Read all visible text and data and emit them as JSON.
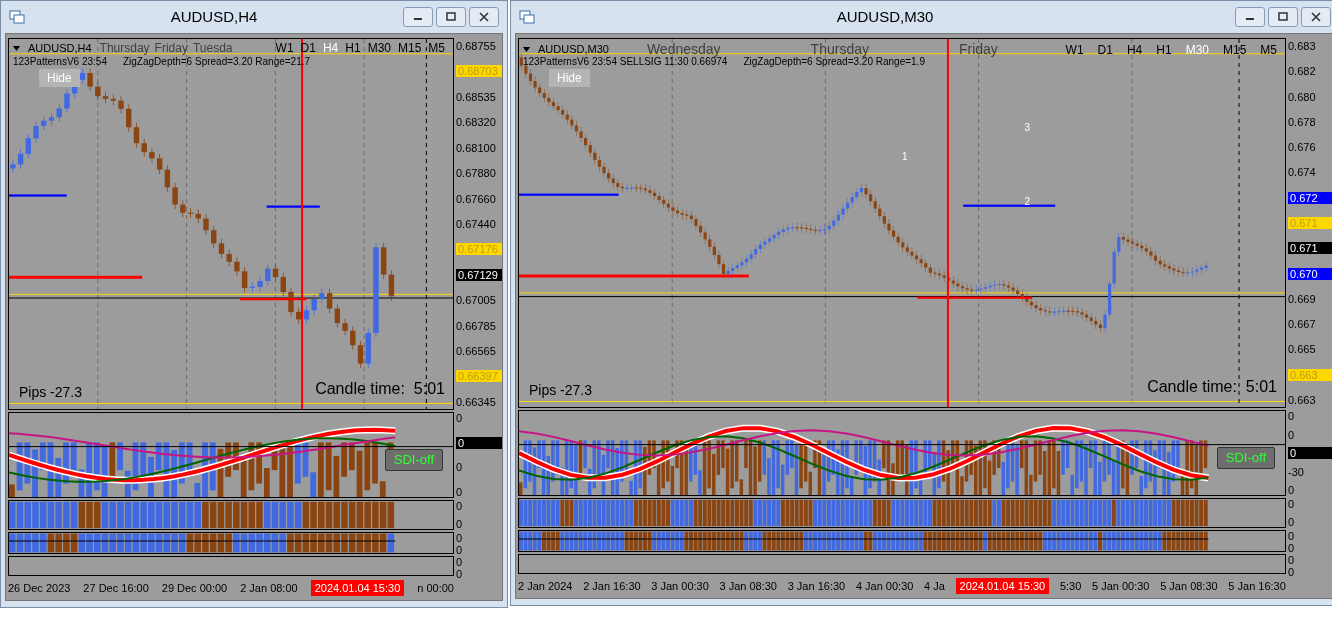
{
  "windows": [
    {
      "title": "AUDUSD,H4",
      "symbol_label": "AUDUSD,H4",
      "indicator_info": "123PatternsV6  23:54",
      "indicator_info_tail": "ZigZagDepth=6  Spread=3.20  Range=21.7",
      "day_labels": [
        "Thursday",
        "Friday",
        "Tuesda"
      ],
      "timeframes": [
        {
          "label": "W1",
          "selected": false
        },
        {
          "label": "D1",
          "selected": false
        },
        {
          "label": "H4",
          "selected": true
        },
        {
          "label": "H1",
          "selected": false
        },
        {
          "label": "M30",
          "selected": false
        },
        {
          "label": "M15",
          "selected": false
        },
        {
          "label": "M5",
          "selected": false
        }
      ],
      "hide_button": "Hide",
      "pips": "Pips -27.3",
      "candle_time": "Candle time:  5:01",
      "sdi_button": "SDI-off",
      "price_axis": [
        {
          "label": "0.68755",
          "kind": "tick"
        },
        {
          "label": "0.68703",
          "kind": "tag",
          "color": "#ffd700"
        },
        {
          "label": "0.68535",
          "kind": "tick"
        },
        {
          "label": "0.68320",
          "kind": "tick"
        },
        {
          "label": "0.68100",
          "kind": "tick"
        },
        {
          "label": "0.67880",
          "kind": "tick"
        },
        {
          "label": "0.67660",
          "kind": "tick"
        },
        {
          "label": "0.67440",
          "kind": "tick"
        },
        {
          "label": "0.67176",
          "kind": "tag",
          "color": "#ffd700"
        },
        {
          "label": "0.67129",
          "kind": "tag",
          "color": "#000000"
        },
        {
          "label": "0.67005",
          "kind": "tick"
        },
        {
          "label": "0.66785",
          "kind": "tick"
        },
        {
          "label": "0.66565",
          "kind": "tick"
        },
        {
          "label": "0.66397",
          "kind": "tag",
          "color": "#ffd700"
        },
        {
          "label": "0.66345",
          "kind": "tick"
        }
      ],
      "indicator_panels": [
        {
          "axis": [
            {
              "label": "0",
              "kind": "tick"
            },
            {
              "label": "0",
              "kind": "tag",
              "color": "#000000"
            },
            {
              "label": "0",
              "kind": "tick"
            },
            {
              "label": "0",
              "kind": "tick"
            }
          ]
        },
        {
          "axis": [
            {
              "label": "0",
              "kind": "tick"
            },
            {
              "label": "0",
              "kind": "tick"
            }
          ]
        },
        {
          "axis": [
            {
              "label": "0",
              "kind": "tick"
            },
            {
              "label": "0",
              "kind": "tick"
            }
          ]
        },
        {
          "axis": [
            {
              "label": "0",
              "kind": "tick"
            },
            {
              "label": "0",
              "kind": "tick"
            }
          ]
        }
      ],
      "time_axis": [
        {
          "label": "26 Dec 2023",
          "kind": "tick"
        },
        {
          "label": "27 Dec 16:00",
          "kind": "tick"
        },
        {
          "label": "29 Dec 00:00",
          "kind": "tick"
        },
        {
          "label": "2 Jan 08:00",
          "kind": "tick"
        },
        {
          "label": "2024.01.04 15:30",
          "kind": "cursor"
        },
        {
          "label": "n 00:00",
          "kind": "tick"
        }
      ]
    },
    {
      "title": "AUDUSD,M30",
      "symbol_label": "AUDUSD,M30",
      "indicator_info": "123PatternsV6  23:54  SELLSIG  11:30  0.66974",
      "indicator_info_tail": "ZigZagDepth=6  Spread=3.20  Range=1.9",
      "day_labels": [
        "Wednesday",
        "Thursday",
        "Friday"
      ],
      "timeframes": [
        {
          "label": "W1",
          "selected": false
        },
        {
          "label": "D1",
          "selected": false
        },
        {
          "label": "H4",
          "selected": false
        },
        {
          "label": "H1",
          "selected": false
        },
        {
          "label": "M30",
          "selected": true
        },
        {
          "label": "M15",
          "selected": false
        },
        {
          "label": "M5",
          "selected": false
        }
      ],
      "hide_button": "Hide",
      "chart_labels": [
        "1",
        "2",
        "3"
      ],
      "pips": "Pips -27.3",
      "candle_time": "Candle time:  5:01",
      "sdi_button": "SDI-off",
      "price_axis": [
        {
          "label": "0.683",
          "kind": "tick"
        },
        {
          "label": "0.682",
          "kind": "tick"
        },
        {
          "label": "0.680",
          "kind": "tick"
        },
        {
          "label": "0.678",
          "kind": "tick"
        },
        {
          "label": "0.676",
          "kind": "tick"
        },
        {
          "label": "0.674",
          "kind": "tick"
        },
        {
          "label": "0.672",
          "kind": "tag",
          "color": "#0000ff"
        },
        {
          "label": "0.671",
          "kind": "tag",
          "color": "#ffd700"
        },
        {
          "label": "0.671",
          "kind": "tag",
          "color": "#000000"
        },
        {
          "label": "0.670",
          "kind": "tag",
          "color": "#0000ff"
        },
        {
          "label": "0.669",
          "kind": "tick"
        },
        {
          "label": "0.667",
          "kind": "tick"
        },
        {
          "label": "0.665",
          "kind": "tick"
        },
        {
          "label": "0.663",
          "kind": "tag",
          "color": "#ffd700"
        },
        {
          "label": "0.663",
          "kind": "tick"
        }
      ],
      "indicator_panels": [
        {
          "axis": [
            {
              "label": "0",
              "kind": "tick"
            },
            {
              "label": "0",
              "kind": "tick"
            },
            {
              "label": "0",
              "kind": "tag",
              "color": "#000000"
            },
            {
              "label": "-30",
              "kind": "tick"
            },
            {
              "label": "0",
              "kind": "tick"
            }
          ]
        },
        {
          "axis": [
            {
              "label": "0",
              "kind": "tick"
            },
            {
              "label": "0",
              "kind": "tick"
            }
          ]
        },
        {
          "axis": [
            {
              "label": "0",
              "kind": "tick"
            },
            {
              "label": "0",
              "kind": "tick"
            }
          ]
        },
        {
          "axis": [
            {
              "label": "0",
              "kind": "tick"
            },
            {
              "label": "0",
              "kind": "tick"
            }
          ]
        }
      ],
      "time_axis": [
        {
          "label": "2 Jan 2024",
          "kind": "tick"
        },
        {
          "label": "2 Jan 16:30",
          "kind": "tick"
        },
        {
          "label": "3 Jan 00:30",
          "kind": "tick"
        },
        {
          "label": "3 Jan 08:30",
          "kind": "tick"
        },
        {
          "label": "3 Jan 16:30",
          "kind": "tick"
        },
        {
          "label": "4 Jan 00:30",
          "kind": "tick"
        },
        {
          "label": "4 Ja",
          "kind": "tick"
        },
        {
          "label": "2024.01.04 15:30",
          "kind": "cursor"
        },
        {
          "label": "5:30",
          "kind": "tick"
        },
        {
          "label": "5 Jan 00:30",
          "kind": "tick"
        },
        {
          "label": "5 Jan 08:30",
          "kind": "tick"
        },
        {
          "label": "5 Jan 16:30",
          "kind": "tick"
        }
      ]
    }
  ]
}
